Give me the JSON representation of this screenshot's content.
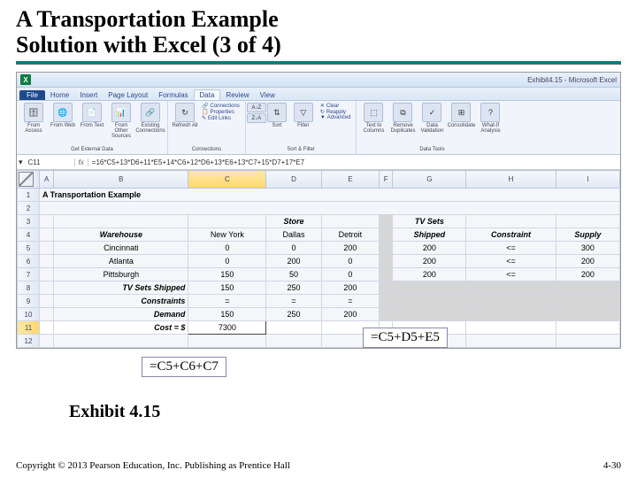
{
  "slide": {
    "title_line1": "A Transportation Example",
    "title_line2": "Solution with Excel (3 of 4)",
    "exhibit": "Exhibit 4.15",
    "copyright": "Copyright © 2013 Pearson Education, Inc. Publishing as Prentice Hall",
    "pagenum": "4-30"
  },
  "callouts": {
    "c1": "=C5+D5+E5",
    "c2": "=C5+C6+C7"
  },
  "excel": {
    "window_title": "Exhibit4.15 - Microsoft Excel",
    "tabs": {
      "file": "File",
      "home": "Home",
      "insert": "Insert",
      "page": "Page Layout",
      "formulas": "Formulas",
      "data": "Data",
      "review": "Review",
      "view": "View"
    },
    "ribbon": {
      "grp1": {
        "title": "Get External Data",
        "items": [
          "From Access",
          "From Web",
          "From Text",
          "From Other Sources",
          "Existing Connections"
        ]
      },
      "grp2": {
        "title": "Connections",
        "refresh": "Refresh All",
        "conn": "Connections",
        "prop": "Properties",
        "edit": "Edit Links"
      },
      "grp3": {
        "title": "Sort & Filter",
        "sort": "Sort",
        "filter": "Filter",
        "clear": "Clear",
        "reapply": "Reapply",
        "adv": "Advanced"
      },
      "grp4": {
        "title": "Data Tools",
        "t2c": "Text to Columns",
        "dup": "Remove Duplicates",
        "val": "Data Validation",
        "cons": "Consolidate",
        "whatif": "What-If Analysis"
      }
    },
    "namebox": "C11",
    "formula": "=16*C5+13*D6+11*E5+14*C6+12*D6+13*E6+13*C7+15*D7+17*E7",
    "columns": [
      "A",
      "B",
      "C",
      "D",
      "E",
      "F",
      "G",
      "H",
      "I"
    ],
    "rows": [
      "1",
      "2",
      "3",
      "4",
      "5",
      "6",
      "7",
      "8",
      "9",
      "10",
      "11",
      "12"
    ],
    "sheet": {
      "A1": "A Transportation Example",
      "D3": "Store",
      "G3": "TV Sets",
      "B4": "Warehouse",
      "C4": "New York",
      "D4": "Dallas",
      "E4": "Detroit",
      "G4": "Shipped",
      "H4": "Constraint",
      "I4": "Supply",
      "B5": "Cincinnati",
      "C5": "0",
      "D5": "0",
      "E5": "200",
      "F5arrow": "",
      "G5": "200",
      "H5": "<=",
      "I5": "300",
      "B6": "Atlanta",
      "C6": "0",
      "D6": "200",
      "E6": "0",
      "G6": "200",
      "H6": "<=",
      "I6": "200",
      "B7": "Pittsburgh",
      "C7": "150",
      "D7": "50",
      "E7": "0",
      "G7": "200",
      "H7": "<=",
      "I7": "200",
      "B8": "TV Sets Shipped",
      "C8": "150",
      "D8": "250",
      "E8": "200",
      "B9": "Constraints",
      "C9": "=",
      "D9": "=",
      "E9": "=",
      "B10": "Demand",
      "C10": "150",
      "D10": "250",
      "E10": "200",
      "B11": "Cost = $",
      "C11": "7300"
    }
  }
}
